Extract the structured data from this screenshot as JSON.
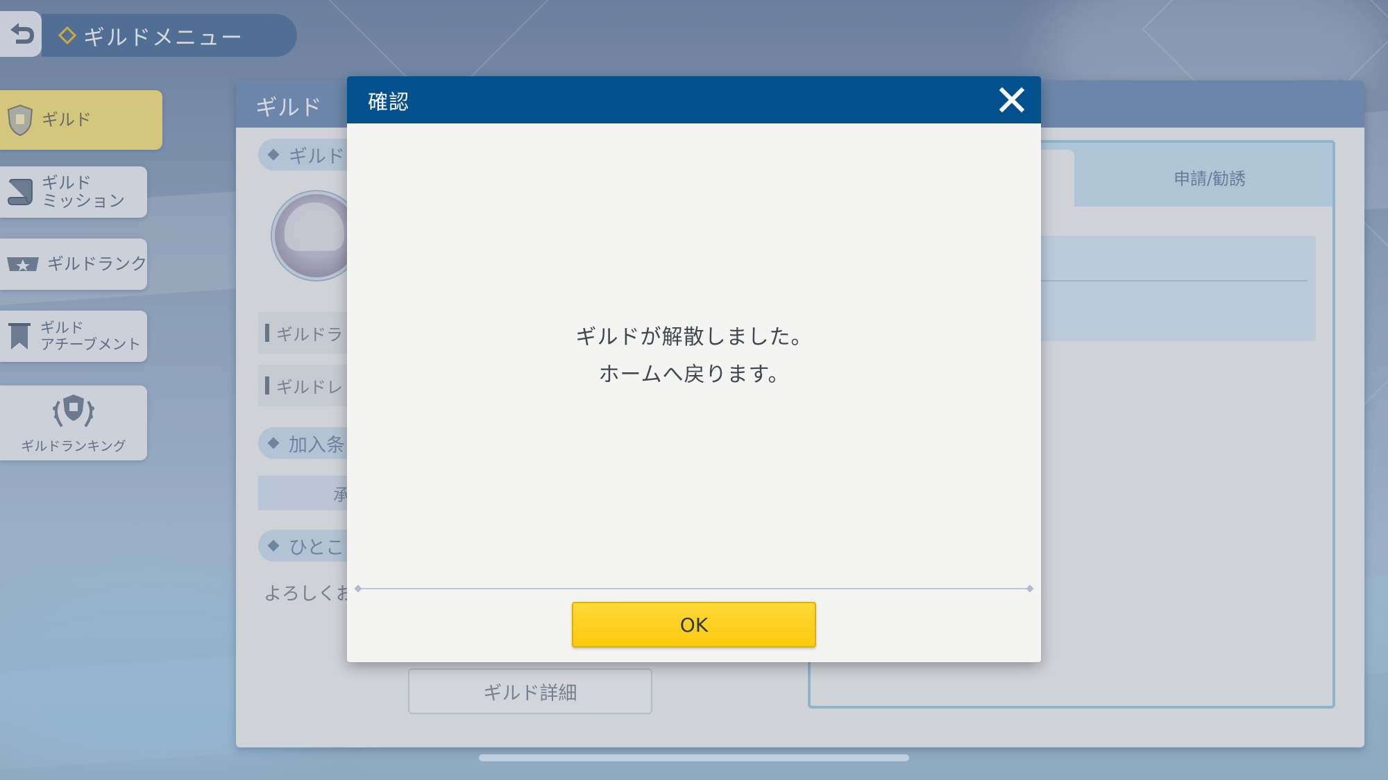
{
  "header": {
    "title": "ギルドメニュー",
    "back_icon": "back-arrow-icon"
  },
  "sidebar": {
    "items": [
      {
        "label": "ギルド",
        "icon": "guild-shield-icon",
        "active": true
      },
      {
        "label_line1": "ギルド",
        "label_line2": "ミッション",
        "icon": "scroll-icon"
      },
      {
        "label": "ギルドランク",
        "icon": "rank-emblem-icon"
      },
      {
        "label_line1": "ギルド",
        "label_line2": "アチーブメント",
        "icon": "banner-icon"
      },
      {
        "label": "ギルドランキング",
        "icon": "laurel-shield-icon"
      }
    ]
  },
  "main": {
    "title": "ギルド",
    "section_guild": "ギルド",
    "row_rank": "ギルドラ",
    "row_level": "ギルドレ",
    "section_join": "加入条",
    "approve": "承認",
    "section_comment": "ひとこ",
    "greeting": "よろしくお",
    "detail_button": "ギルド詳細",
    "tab_apply": "申請/勧誘"
  },
  "dialog": {
    "title": "確認",
    "message_line1": "ギルドが解散しました。",
    "message_line2": "ホームへ戻ります。",
    "ok_label": "OK",
    "close_icon": "close-x-icon"
  },
  "colors": {
    "dialog_header": "#02508e",
    "ok_button": "#fbc90f",
    "active_menu": "#fde98a"
  }
}
